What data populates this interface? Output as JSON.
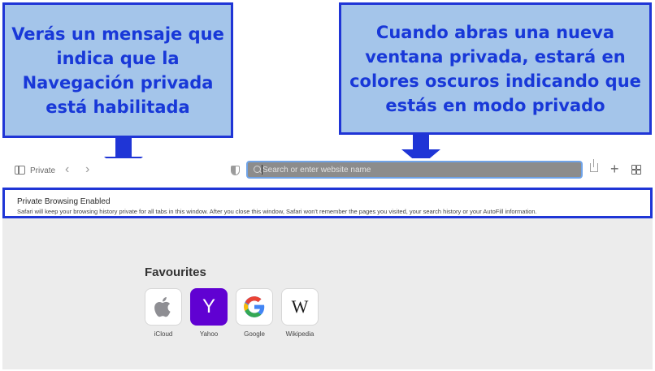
{
  "annotations": {
    "left": "Verás un mensaje que indica que la Navegación privada está habilitada",
    "right": "Cuando abras una nueva ventana privada, estará en colores oscuros indicando que estás en modo privado",
    "color": "#1f35d6",
    "fill": "#a4c5ea"
  },
  "toolbar": {
    "sidebar_icon": "sidebar-icon",
    "private_label": "Private",
    "address_placeholder": "Search or enter website name",
    "address_bar_color": "#8c8c8c"
  },
  "banner": {
    "title": "Private Browsing Enabled",
    "text": "Safari will keep your browsing history private for all tabs in this window. After you close this window, Safari won't remember the pages you visited, your search history or your AutoFill information."
  },
  "favourites": {
    "title": "Favourites",
    "items": [
      {
        "label": "iCloud",
        "icon": "apple-icon"
      },
      {
        "label": "Yahoo",
        "icon": "yahoo-icon",
        "glyph": "Y"
      },
      {
        "label": "Google",
        "icon": "google-icon"
      },
      {
        "label": "Wikipedia",
        "icon": "wikipedia-icon",
        "glyph": "W"
      }
    ]
  }
}
